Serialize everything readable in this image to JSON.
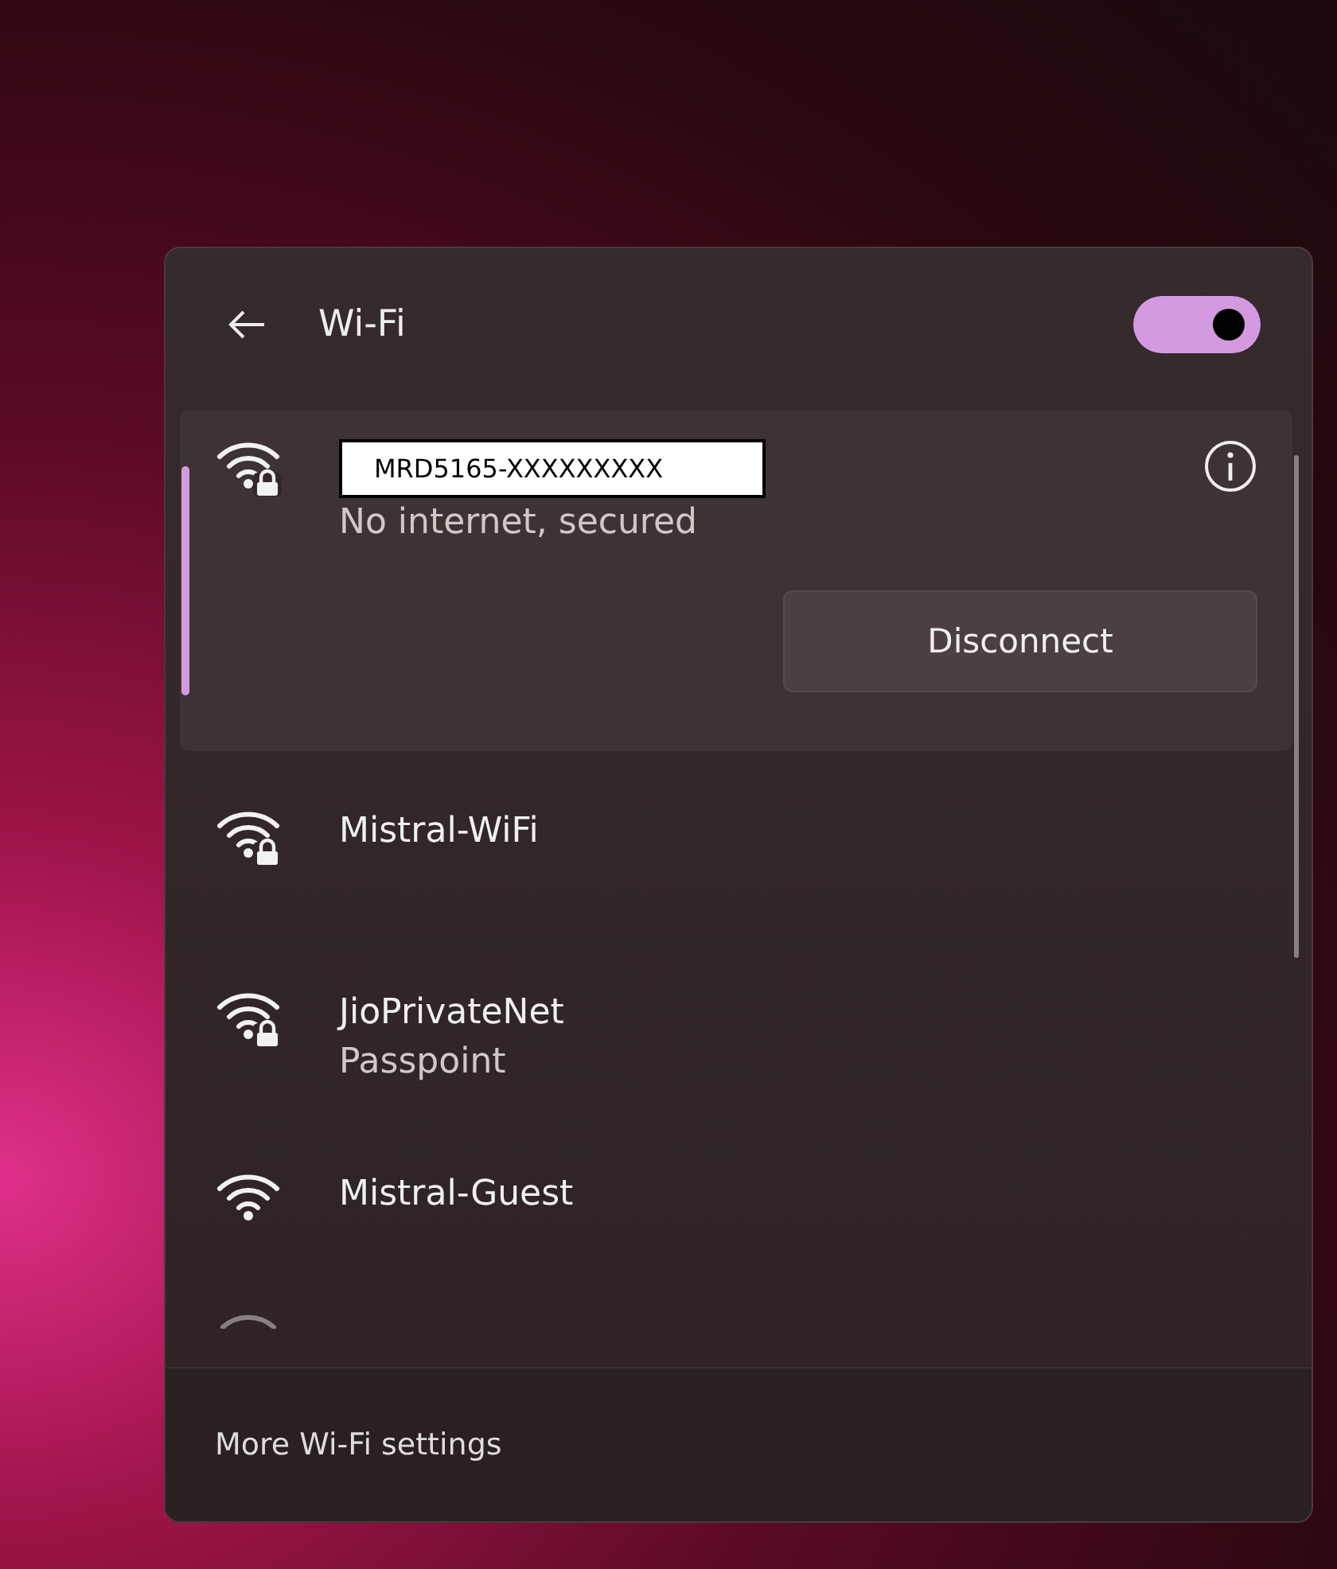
{
  "header": {
    "title": "Wi-Fi",
    "wifi_on": true
  },
  "networks": [
    {
      "name": "MRD5165-XXXXXXXXX",
      "status": "No internet, secured",
      "secured": true,
      "selected": true,
      "action": "Disconnect"
    },
    {
      "name": "Mistral-WiFi",
      "secured": true,
      "selected": false
    },
    {
      "name": "JioPrivateNet",
      "status": "Passpoint",
      "secured": true,
      "selected": false
    },
    {
      "name": "Mistral-Guest",
      "secured": false,
      "selected": false
    }
  ],
  "footer": {
    "link": "More Wi-Fi settings"
  }
}
